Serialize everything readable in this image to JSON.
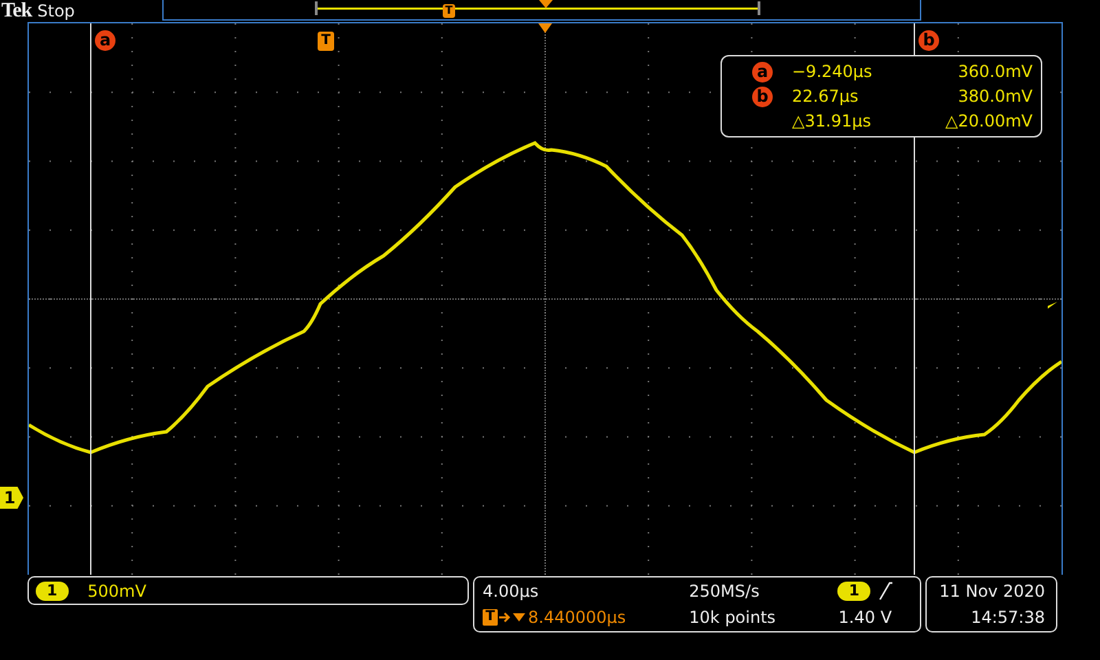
{
  "header": {
    "brand": "Tek",
    "status": "Stop",
    "overview_marker": "T"
  },
  "cursors": [
    {
      "label": "a"
    },
    {
      "label": "b"
    }
  ],
  "trigger_marker": "T",
  "readout": [
    {
      "label": "a",
      "time": "−9.240µs",
      "voltage": "360.0mV"
    },
    {
      "label": "b",
      "time": "22.67µs",
      "voltage": "380.0mV"
    },
    {
      "time": "△31.91µs",
      "voltage": "△20.00mV"
    }
  ],
  "channel_marker": "1",
  "channel_panel": {
    "channel": "1",
    "scale": "500mV"
  },
  "horizontal": {
    "scale": "4.00µs",
    "sample_rate": "250MS/s",
    "delay_marker": "T",
    "delay": "8.440000µs",
    "record_length": "10k points"
  },
  "trigger": {
    "channel": "1",
    "level": "1.40 V"
  },
  "datetime": {
    "date": "11 Nov 2020",
    "time": "14:57:38"
  }
}
